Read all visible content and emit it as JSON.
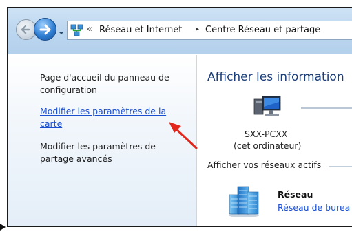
{
  "address_bar": {
    "crumbs": [
      "Réseau et Internet",
      "Centre Réseau et partage"
    ],
    "overflow_chevron": "«",
    "separator": "▸"
  },
  "left_pane": {
    "home_link": "Page d'accueil du panneau de configuration",
    "adapter_link": "Modifier les paramètres de la carte",
    "sharing_link": "Modifier les paramètres de partage avancés"
  },
  "content": {
    "heading": "Afficher les information",
    "computer_name": "SXX-PCXX",
    "computer_subtitle": "(cet ordinateur)",
    "active_networks_title": "Afficher vos réseaux actifs",
    "network_name": "Réseau",
    "network_type": "Réseau de burea"
  },
  "colors": {
    "link": "#1a4fd0",
    "heading": "#1a3c78",
    "annotation_arrow": "#e3261c"
  },
  "icons": [
    "back-icon",
    "forward-icon",
    "dropdown-icon",
    "network-center-icon",
    "computer-icon",
    "network-building-icon",
    "annotation-arrow-icon",
    "cursor-icon"
  ]
}
